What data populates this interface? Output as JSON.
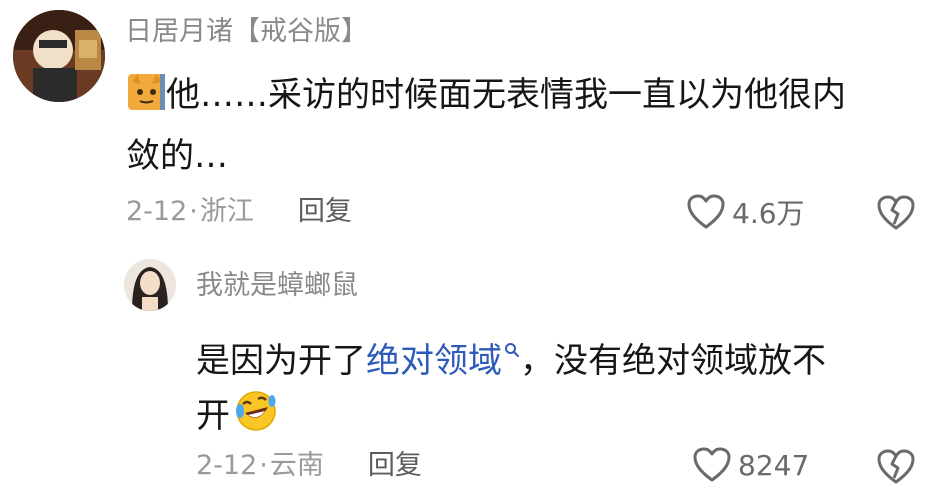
{
  "comments": [
    {
      "username": "日居月诸【戒谷版】",
      "text_line1": "他……采访的时候面无表情我一直以为他很内",
      "text_line2": "敛的…",
      "date": "2-12",
      "separator": "·",
      "location": "浙江",
      "reply_label": "回复",
      "likes": "4.6万"
    },
    {
      "username": "我就是蟑螂鼠",
      "text_pre": "是因为开了",
      "link_text": "绝对领域",
      "text_post": "，没有绝对领域放不",
      "text_line2": "开",
      "date": "2-12",
      "separator": "·",
      "location": "云南",
      "reply_label": "回复",
      "likes": "8247"
    }
  ],
  "icons": {
    "cat_emoji": "cat-emoji-icon",
    "laughing_emoji": "laughing-crying-emoji-icon",
    "search": "search-icon",
    "heart": "heart-icon",
    "broken_heart": "broken-heart-icon"
  },
  "colors": {
    "username": "#8a8a8a",
    "text": "#161616",
    "meta": "#9a9a9a",
    "link": "#2e5bba"
  }
}
